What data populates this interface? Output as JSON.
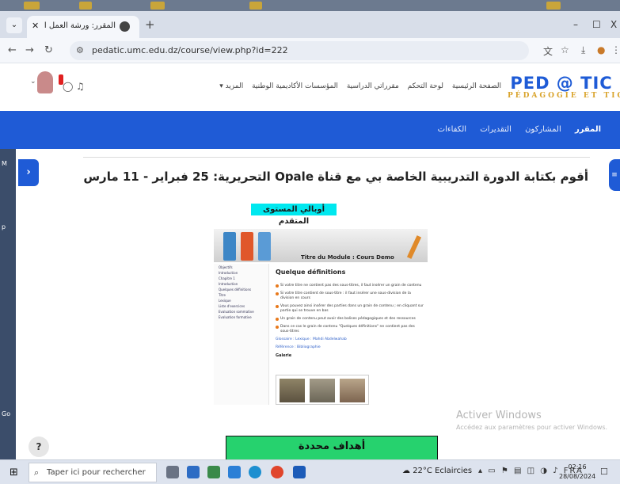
{
  "browser": {
    "tab_title": "المقرر: ورشة العمل الأولى: أدوات",
    "url": "pedatic.umc.edu.dz/course/view.php?id=222",
    "new_tab": "+",
    "minimize": "–",
    "maximize": "☐",
    "close": "X"
  },
  "site_header": {
    "nav_items": [
      "الصفحة الرئيسية",
      "لوحة التحكم",
      "مقرراتي الدراسية",
      "المؤسسات الأكاديمية الوطنية",
      "المزيد ▾"
    ],
    "logo_main": "PED @ TIC",
    "logo_sub": "PÉDAGOGIE ET TIC"
  },
  "course_nav": {
    "items": [
      "المقرر",
      "المشاركون",
      "التقديرات",
      "الكفاءات"
    ]
  },
  "section": {
    "title": "أقوم بكتابة الدورة التدريبية الخاصة بي مع قناة Opale التحريرية: 25 فبراير - 11 مارس 2024",
    "level_badge": "أوبالي المستوى المتقدم",
    "goals_title": "أهداف محددة"
  },
  "opale_preview": {
    "module_title": "Titre du Module : Cours Demo",
    "heading": "Quelque définitions",
    "sidebar": [
      "Objectifs",
      "Introduction",
      "Chapitre 1",
      "Introduction",
      "Quelques définitions",
      "Titre",
      "Lexique",
      "Liste d'exercices",
      "Evaluation sommative",
      "Evaluation formative"
    ],
    "paragraphs": [
      "Si votre titre ne contient pas des sous-titres, il faut insérer un grain de contenu",
      "Si votre titre contient de sous-titre : il faut insérer une sous-division de la division en cours",
      "Vous pouvez ainsi insérer des parties dans un grain de contenu ; en cliquant sur partie qui se trouve en bas",
      "Un grain de contenu peut avoir des balises pédagogiques et des ressources",
      "Dans ce cas le grain de contenu \"Quelques définitions\" ne contient pas des sous-titres"
    ],
    "links": [
      "Glossaire : Lexique : Mahdi Abdelwahab",
      "Référence : Bibliographie"
    ],
    "gallery_label": "Galerie"
  },
  "watermark": {
    "line1": "Activer Windows",
    "line2": "Accédez aux paramètres pour activer Windows."
  },
  "help_button": "?",
  "taskbar": {
    "search_placeholder": "Taper ici pour rechercher",
    "weather": "22°C Eclaircies",
    "language": "FRA",
    "time": "02:16",
    "date": "28/08/2024"
  },
  "colors": {
    "brand_blue": "#1f5bd6",
    "level_badge": "#00e8ef",
    "goals_green": "#26d26e"
  }
}
